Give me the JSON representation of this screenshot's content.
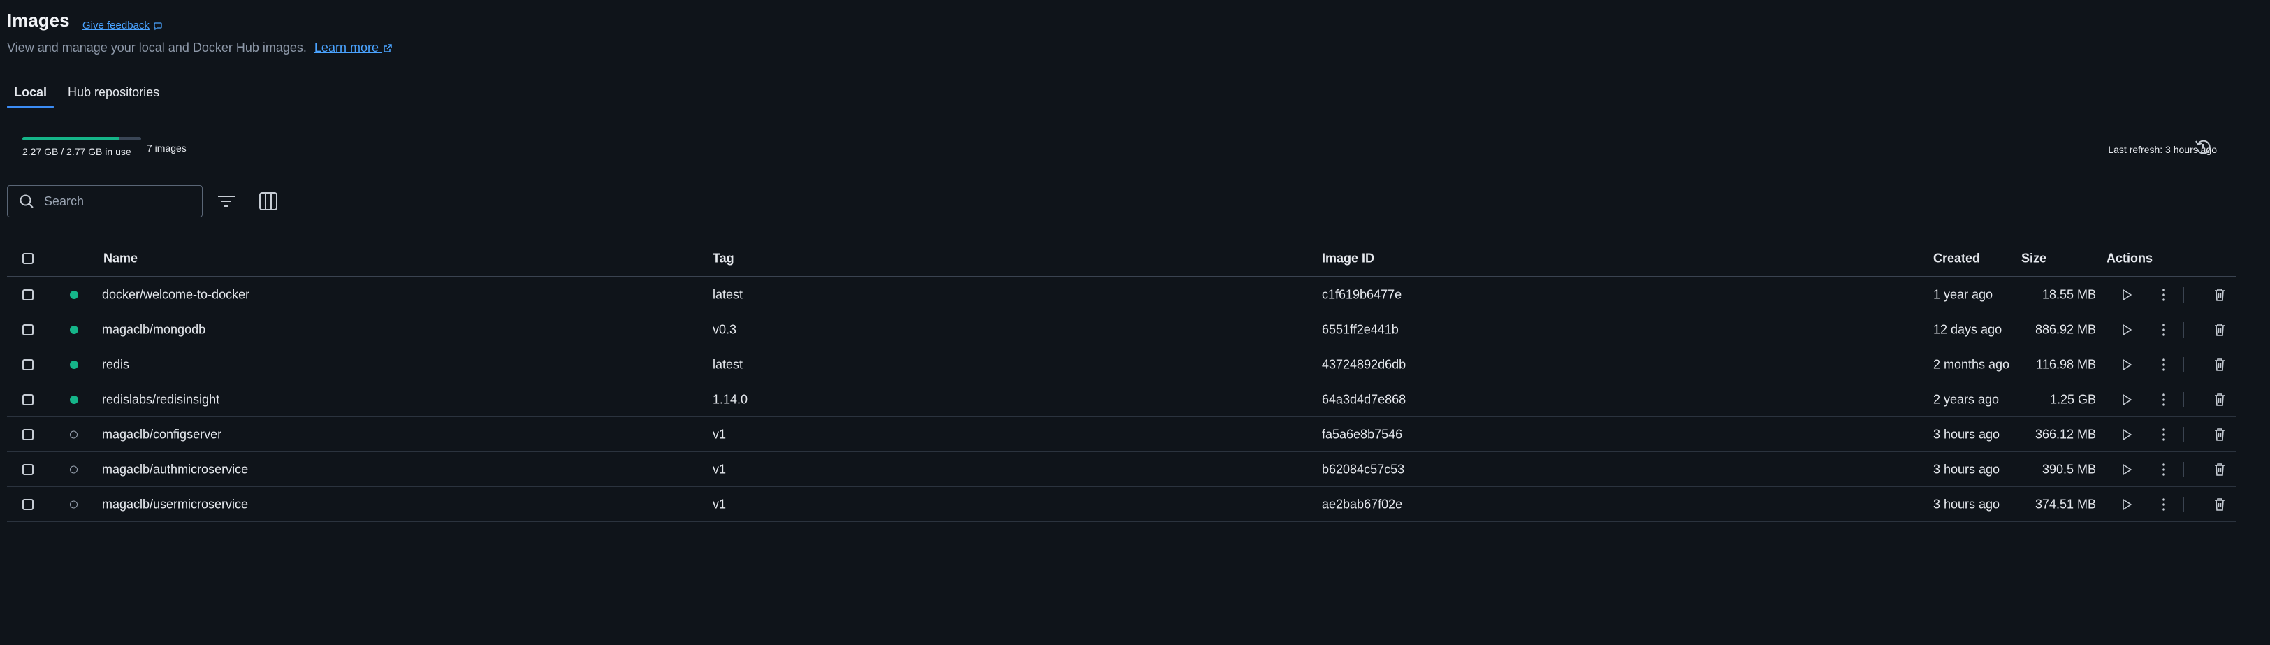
{
  "header": {
    "title": "Images",
    "feedback_label": "Give feedback",
    "subtitle": "View and manage your local and Docker Hub images.",
    "learn_more": "Learn more"
  },
  "tabs": [
    {
      "label": "Local",
      "active": true
    },
    {
      "label": "Hub repositories",
      "active": false
    }
  ],
  "usage": {
    "text": "2.27 GB / 2.77 GB in use",
    "image_count": "7 images",
    "used_fraction": 0.82,
    "bar_color": "#15b589"
  },
  "refresh": {
    "label": "Last refresh: 3 hours ago",
    "icon": "refresh-icon"
  },
  "search": {
    "placeholder": "Search",
    "icon": "search-icon"
  },
  "toolbar": {
    "filter_icon": "filter-icon",
    "columns_icon": "columns-icon"
  },
  "table": {
    "headers": {
      "name": "Name",
      "tag": "Tag",
      "image_id": "Image ID",
      "created": "Created",
      "size": "Size",
      "actions": "Actions"
    },
    "rows": [
      {
        "name": "docker/welcome-to-docker",
        "tag": "latest",
        "image_id": "c1f619b6477e",
        "created": "1 year ago",
        "size": "18.55 MB",
        "in_use": true
      },
      {
        "name": "magaclb/mongodb",
        "tag": "v0.3",
        "image_id": "6551ff2e441b",
        "created": "12 days ago",
        "size": "886.92 MB",
        "in_use": true
      },
      {
        "name": "redis",
        "tag": "latest",
        "image_id": "43724892d6db",
        "created": "2 months ago",
        "size": "116.98 MB",
        "in_use": true
      },
      {
        "name": "redislabs/redisinsight",
        "tag": "1.14.0",
        "image_id": "64a3d4d7e868",
        "created": "2 years ago",
        "size": "1.25 GB",
        "in_use": true
      },
      {
        "name": "magaclb/configserver",
        "tag": "v1",
        "image_id": "fa5a6e8b7546",
        "created": "3 hours ago",
        "size": "366.12 MB",
        "in_use": false
      },
      {
        "name": "magaclb/authmicroservice",
        "tag": "v1",
        "image_id": "b62084c57c53",
        "created": "3 hours ago",
        "size": "390.5 MB",
        "in_use": false
      },
      {
        "name": "magaclb/usermicroservice",
        "tag": "v1",
        "image_id": "ae2bab67f02e",
        "created": "3 hours ago",
        "size": "374.51 MB",
        "in_use": false
      }
    ]
  },
  "colors": {
    "background": "#0f141a",
    "accent": "#3b8cf5",
    "link": "#4aa3ff",
    "in_use_dot": "#15b589"
  }
}
